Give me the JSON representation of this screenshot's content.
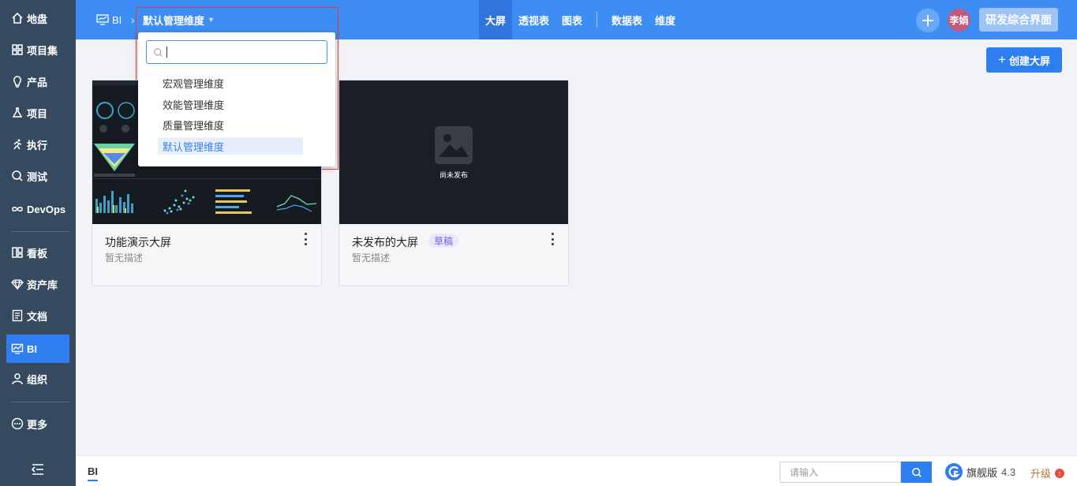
{
  "sidebar": {
    "items": [
      {
        "label": "地盘",
        "icon": "home-icon"
      },
      {
        "label": "项目集",
        "icon": "grid-icon"
      },
      {
        "label": "产品",
        "icon": "lightbulb-icon"
      },
      {
        "label": "项目",
        "icon": "flask-icon"
      },
      {
        "label": "执行",
        "icon": "run-icon"
      },
      {
        "label": "测试",
        "icon": "search-icon"
      },
      {
        "label": "DevOps",
        "icon": "infinity-icon"
      },
      {
        "label": "看板",
        "icon": "kanban-icon"
      },
      {
        "label": "资产库",
        "icon": "diamond-icon"
      },
      {
        "label": "文档",
        "icon": "document-icon"
      },
      {
        "label": "BI",
        "icon": "monitor-chart-icon"
      },
      {
        "label": "组织",
        "icon": "person-icon"
      },
      {
        "label": "更多",
        "icon": "more-circle-icon"
      }
    ],
    "active": "BI"
  },
  "header": {
    "breadcrumb_root": "BI",
    "breadcrumb_sep": "›",
    "dimension": "默认管理维度",
    "tabs": [
      "大屏",
      "透视表",
      "图表",
      "数据表",
      "维度"
    ],
    "active_tab": "大屏",
    "avatar_name": "李娟",
    "workspace_button": "研发综合界面"
  },
  "dimension_dropdown": {
    "search_placeholder": "",
    "options": [
      "宏观管理维度",
      "效能管理维度",
      "质量管理维度",
      "默认管理维度"
    ],
    "selected": "默认管理维度"
  },
  "main": {
    "create_button": "创建大屏",
    "cards": [
      {
        "title": "功能演示大屏",
        "description": "暂无描述",
        "badge": ""
      },
      {
        "title": "未发布的大屏",
        "description": "暂无描述",
        "badge": "草稿",
        "thumbnail_text": "尚未发布"
      }
    ]
  },
  "footer": {
    "tab": "BI",
    "search_placeholder": "请输入",
    "edition": "旗舰版",
    "version": "4.3",
    "upgrade": "升级"
  },
  "colors": {
    "topbar": "#3d8df5",
    "sidebar": "#354a5f",
    "accent": "#2f7ef0",
    "draft_badge": "#7366d6"
  }
}
